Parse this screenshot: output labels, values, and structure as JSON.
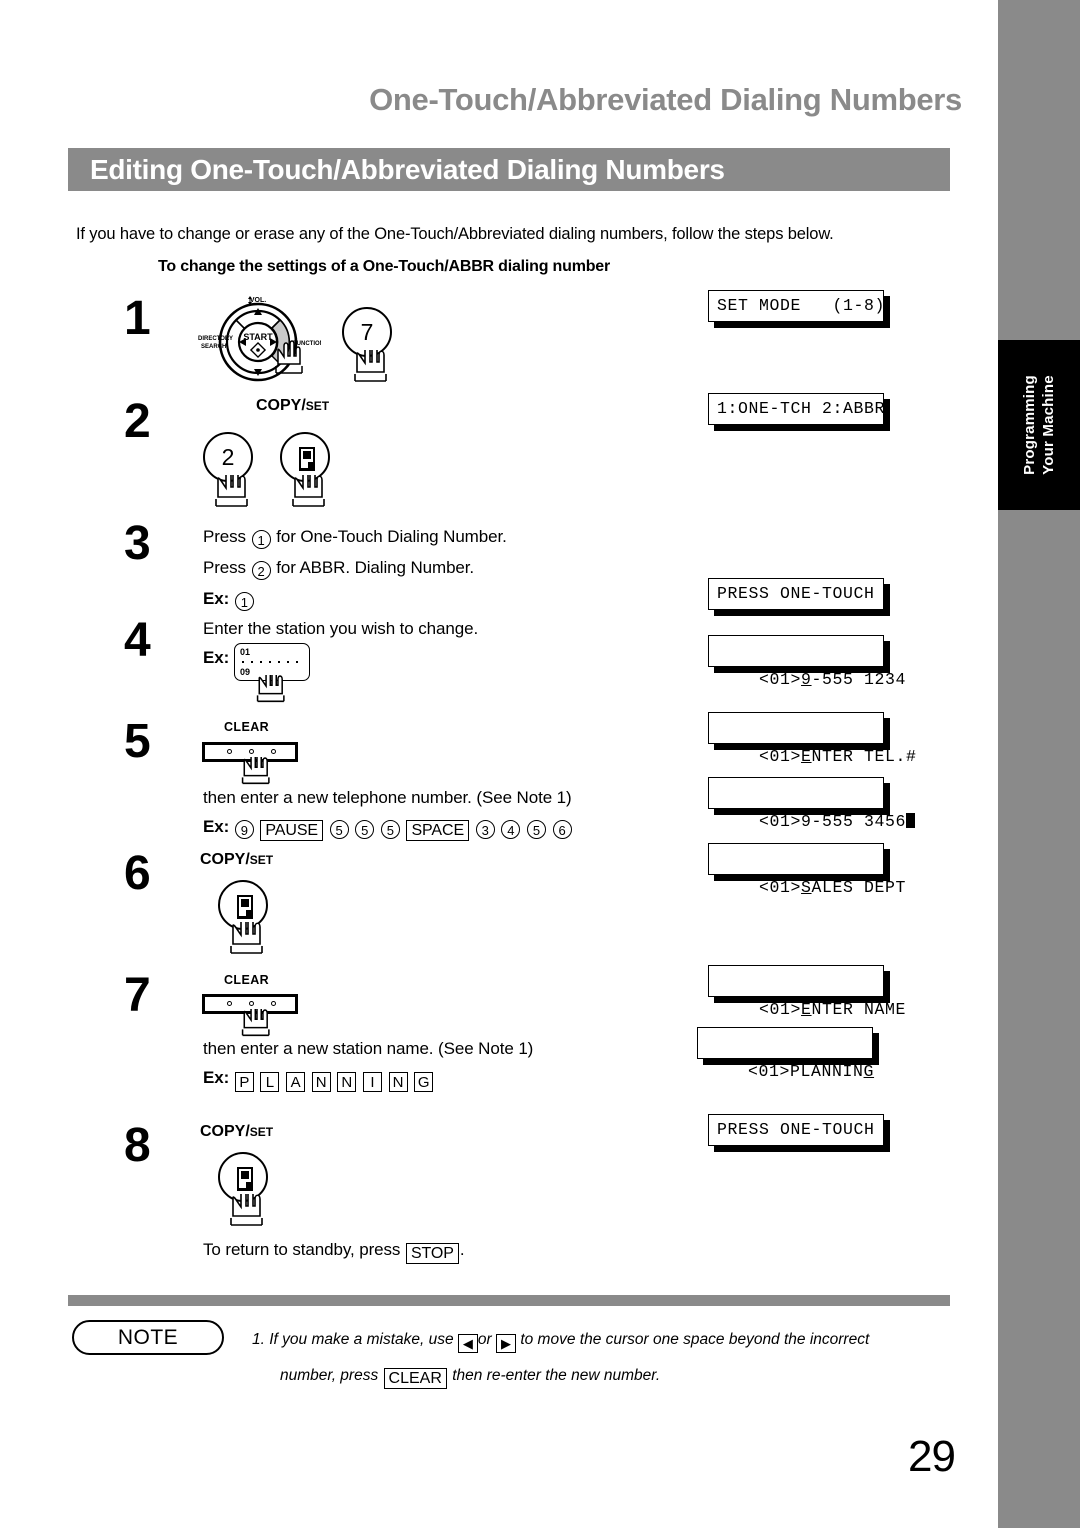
{
  "chapter_title": "One-Touch/Abbreviated Dialing Numbers",
  "section_title": "Editing One-Touch/Abbreviated Dialing Numbers",
  "intro": "If you have to change or erase any of the One-Touch/Abbreviated dialing numbers, follow the steps below.",
  "subhead": "To change the settings of a One-Touch/ABBR dialing number",
  "side_tab": {
    "line1": "Programming",
    "line2": "Your Machine"
  },
  "page_number": "29",
  "colors": {
    "gray": "#8a8a8a",
    "black": "#000000",
    "white": "#ffffff"
  },
  "dialpad": {
    "center": "START",
    "top": "VOL.",
    "left": "DIRECTORY",
    "left2": "SEARCH",
    "right": "FUNCTION"
  },
  "steps": [
    {
      "num": "1",
      "keycap": "7"
    },
    {
      "num": "2",
      "label": "COPY / SET",
      "label_big": "COPY",
      "label_slash": "/",
      "label_small": "SET",
      "keycap": "2"
    },
    {
      "num": "3",
      "line1_a": "Press",
      "line1_key": "1",
      "line1_b": "for One-Touch Dialing Number.",
      "line2_a": "Press",
      "line2_key": "2",
      "line2_b": "for ABBR. Dialing Number.",
      "ex_label": "Ex:",
      "ex_key": "1"
    },
    {
      "num": "4",
      "line1": "Enter the station you wish to change.",
      "ex_label": "Ex:",
      "panel_top": "01",
      "panel_bottom": "09"
    },
    {
      "num": "5",
      "button": "CLEAR",
      "line1": "then enter a new telephone number. (See Note 1)",
      "ex_label": "Ex:",
      "ex_keys": [
        {
          "t": "9",
          "k": "circle"
        },
        {
          "t": "PAUSE",
          "k": "box"
        },
        {
          "t": "5",
          "k": "circle"
        },
        {
          "t": "5",
          "k": "circle"
        },
        {
          "t": "5",
          "k": "circle"
        },
        {
          "t": "SPACE",
          "k": "box"
        },
        {
          "t": "3",
          "k": "circle"
        },
        {
          "t": "4",
          "k": "circle"
        },
        {
          "t": "5",
          "k": "circle"
        },
        {
          "t": "6",
          "k": "circle"
        }
      ]
    },
    {
      "num": "6",
      "label_big": "COPY",
      "label_slash": "/",
      "label_small": "SET"
    },
    {
      "num": "7",
      "button": "CLEAR",
      "line1": "then enter a new station name. (See Note 1)",
      "ex_label": "Ex:",
      "ex_keys": [
        {
          "t": "P"
        },
        {
          "t": "L"
        },
        {
          "t": "A"
        },
        {
          "t": "N"
        },
        {
          "t": "N"
        },
        {
          "t": "I"
        },
        {
          "t": "N"
        },
        {
          "t": "G"
        }
      ]
    },
    {
      "num": "8",
      "label_big": "COPY",
      "label_slash": "/",
      "label_small": "SET",
      "standby_a": "To return to standby, press",
      "standby_key": "STOP",
      "standby_b": "."
    }
  ],
  "displays": [
    {
      "id": "d1",
      "text": "SET MODE   (1-8)"
    },
    {
      "id": "d2",
      "text": "1:ONE-TCH 2:ABBR"
    },
    {
      "id": "d3",
      "text": "PRESS ONE-TOUCH"
    },
    {
      "id": "d4",
      "pre": "<01>",
      "cursor": "9",
      "post": "-555 1234"
    },
    {
      "id": "d5",
      "pre": "<01>",
      "cursor": "E",
      "post": "NTER TEL.#"
    },
    {
      "id": "d6",
      "pre": "<01>9-555 3456",
      "block": true
    },
    {
      "id": "d7",
      "pre": "<01>",
      "cursor": "S",
      "post": "ALES DEPT"
    },
    {
      "id": "d8",
      "pre": "<01>",
      "cursor": "E",
      "post": "NTER NAME"
    },
    {
      "id": "d9",
      "pre": "<01>PLANNIN",
      "cursor": "G",
      "post": ""
    },
    {
      "id": "d10",
      "text": "PRESS ONE-TOUCH"
    }
  ],
  "note": {
    "badge": "NOTE",
    "line1_a": "1. If you make a mistake, use",
    "arrow_left": "◀",
    "line1_or": "or",
    "arrow_right": "▶",
    "line1_b": "to move the cursor one space beyond the incorrect",
    "line2_a": "number, press",
    "line2_key": "CLEAR",
    "line2_b": "then re-enter the new number."
  }
}
